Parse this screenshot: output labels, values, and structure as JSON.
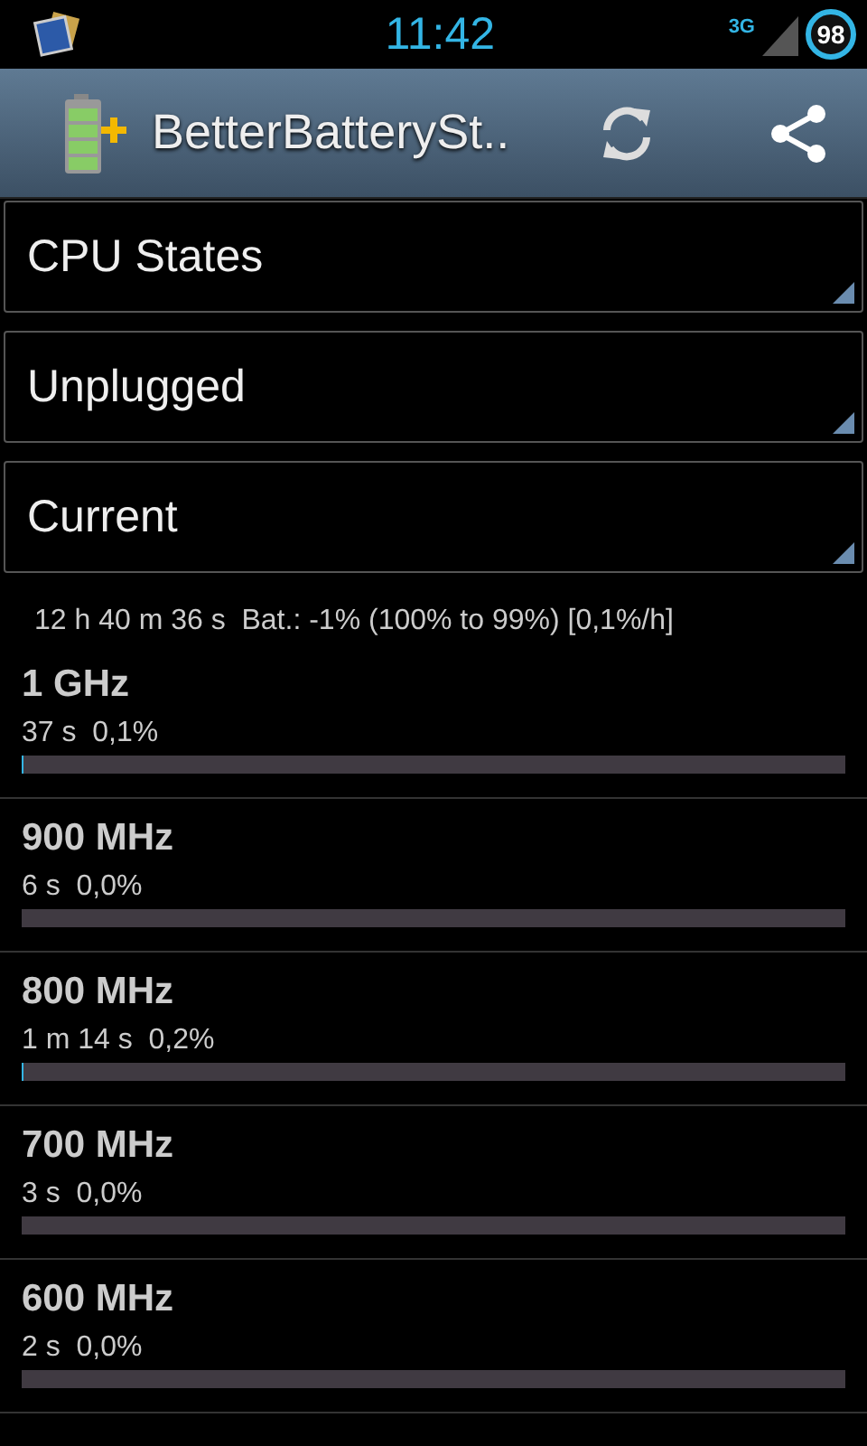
{
  "status_bar": {
    "time": "11:42",
    "network": "3G",
    "battery": "98"
  },
  "action_bar": {
    "title": "BetterBatterySt.."
  },
  "spinners": [
    {
      "value": "CPU States"
    },
    {
      "value": "Unplugged"
    },
    {
      "value": "Current"
    }
  ],
  "summary": "12 h 40 m 36 s  Bat.: -1% (100% to 99%) [0,1%/h]",
  "states": [
    {
      "name": "1 GHz",
      "detail": "37 s  0,1%",
      "level": 0.001
    },
    {
      "name": "900 MHz",
      "detail": "6 s  0,0%",
      "level": 0
    },
    {
      "name": "800 MHz",
      "detail": "1 m 14 s  0,2%",
      "level": 0.002
    },
    {
      "name": "700 MHz",
      "detail": "3 s  0,0%",
      "level": 0
    },
    {
      "name": "600 MHz",
      "detail": "2 s  0,0%",
      "level": 0
    }
  ]
}
